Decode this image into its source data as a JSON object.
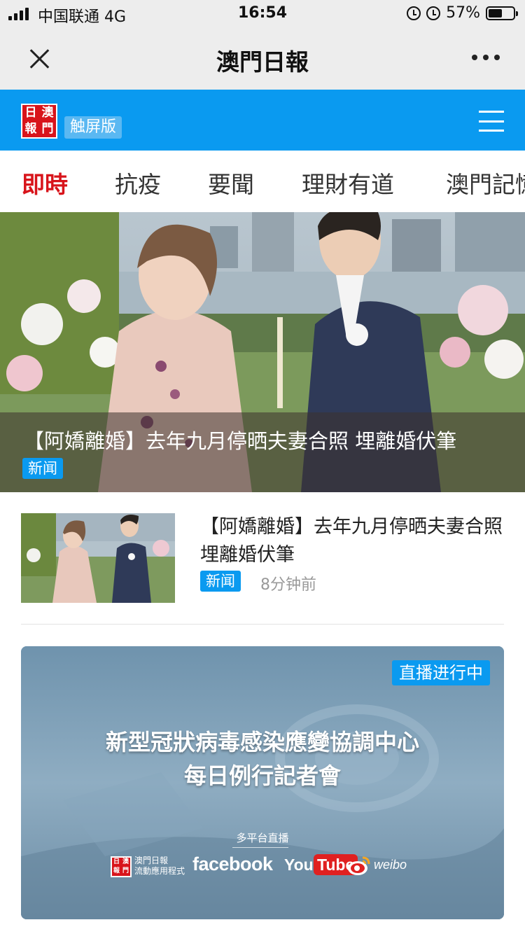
{
  "status_bar": {
    "carrier": "中国联通 4G",
    "time": "16:54",
    "battery": "57%",
    "battery_level": 0.57
  },
  "title_bar": {
    "title": "澳門日報",
    "close_icon": "close-icon",
    "more_icon": "more-icon"
  },
  "site_header": {
    "logo_chars": [
      "日",
      "澳",
      "報",
      "門"
    ],
    "edition": "触屏版",
    "menu_icon": "menu-icon",
    "brand_color": "#0a9af0"
  },
  "tabs": [
    {
      "label": "即時",
      "active": true
    },
    {
      "label": "抗疫",
      "active": false
    },
    {
      "label": "要聞",
      "active": false
    },
    {
      "label": "理財有道",
      "active": false
    },
    {
      "label": "澳門記憶",
      "active": false
    }
  ],
  "hero": {
    "title": "【阿嬌離婚】去年九月停晒夫妻合照 埋離婚伏筆",
    "tag": "新闻"
  },
  "news_list": [
    {
      "title": "【阿嬌離婚】去年九月停晒夫妻合照 埋離婚伏筆",
      "tag": "新闻",
      "time": "8分钟前"
    }
  ],
  "live_banner": {
    "badge": "直播进行中",
    "title_line1": "新型冠狀病毒感染應變協調中心",
    "title_line2": "每日例行記者會",
    "platforms_label": "多平台直播",
    "app_name_line1": "澳門日報",
    "app_name_line2": "流動應用程式",
    "facebook": "facebook",
    "youtube_you": "You",
    "youtube_tube": "Tube",
    "weibo": "weibo"
  },
  "colors": {
    "accent_red": "#d8141b",
    "tag_blue": "#0a9af0"
  }
}
